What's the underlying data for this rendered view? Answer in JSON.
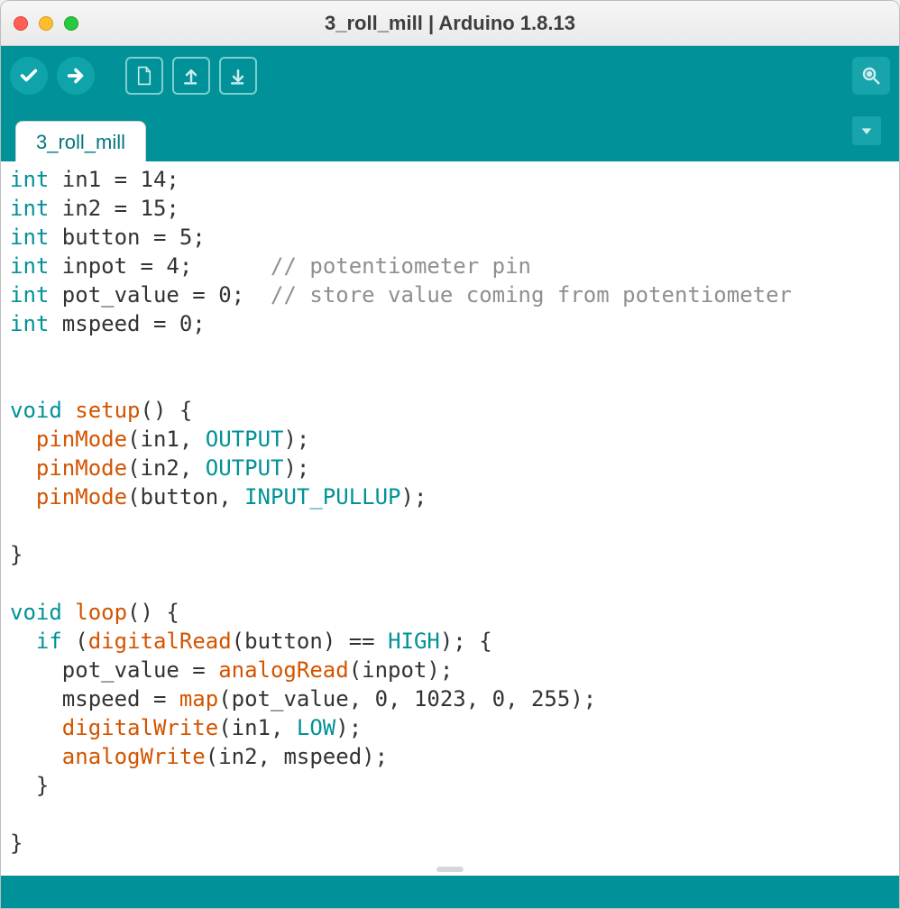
{
  "window": {
    "title": "3_roll_mill | Arduino 1.8.13"
  },
  "tabs": {
    "active_label": "3_roll_mill"
  },
  "code": {
    "lines": [
      {
        "t": "decl",
        "type": "int",
        "name": "in1",
        "val": "14",
        "cm": ""
      },
      {
        "t": "decl",
        "type": "int",
        "name": "in2",
        "val": "15",
        "cm": ""
      },
      {
        "t": "decl",
        "type": "int",
        "name": "button",
        "val": "5",
        "cm": ""
      },
      {
        "t": "decl",
        "type": "int",
        "name": "inpot",
        "val": "4",
        "cm": "// potentiometer pin"
      },
      {
        "t": "decl",
        "type": "int",
        "name": "pot_value",
        "val": "0",
        "cm": "// store value coming from potentiometer"
      },
      {
        "t": "decl",
        "type": "int",
        "name": "mspeed",
        "val": "0",
        "cm": ""
      },
      {
        "t": "blank"
      },
      {
        "t": "blank"
      },
      {
        "t": "raw",
        "seg": [
          [
            "kw",
            "void "
          ],
          [
            "func",
            "setup"
          ],
          [
            "",
            "() {"
          ]
        ]
      },
      {
        "t": "raw",
        "seg": [
          [
            "",
            "  "
          ],
          [
            "func",
            "pinMode"
          ],
          [
            "",
            "(in1, "
          ],
          [
            "const",
            "OUTPUT"
          ],
          [
            "",
            ");"
          ]
        ]
      },
      {
        "t": "raw",
        "seg": [
          [
            "",
            "  "
          ],
          [
            "func",
            "pinMode"
          ],
          [
            "",
            "(in2, "
          ],
          [
            "const",
            "OUTPUT"
          ],
          [
            "",
            ");"
          ]
        ]
      },
      {
        "t": "raw",
        "seg": [
          [
            "",
            "  "
          ],
          [
            "func",
            "pinMode"
          ],
          [
            "",
            "(button, "
          ],
          [
            "const",
            "INPUT_PULLUP"
          ],
          [
            "",
            ");"
          ]
        ]
      },
      {
        "t": "blank"
      },
      {
        "t": "raw",
        "seg": [
          [
            "",
            "}"
          ]
        ]
      },
      {
        "t": "blank"
      },
      {
        "t": "raw",
        "seg": [
          [
            "kw",
            "void "
          ],
          [
            "func",
            "loop"
          ],
          [
            "",
            "() {"
          ]
        ]
      },
      {
        "t": "raw",
        "seg": [
          [
            "",
            "  "
          ],
          [
            "kw",
            "if"
          ],
          [
            "",
            " ("
          ],
          [
            "func",
            "digitalRead"
          ],
          [
            "",
            "(button) == "
          ],
          [
            "const",
            "HIGH"
          ],
          [
            "",
            "); {"
          ]
        ]
      },
      {
        "t": "raw",
        "seg": [
          [
            "",
            "    pot_value = "
          ],
          [
            "func",
            "analogRead"
          ],
          [
            "",
            "(inpot);"
          ]
        ]
      },
      {
        "t": "raw",
        "seg": [
          [
            "",
            "    mspeed = "
          ],
          [
            "func",
            "map"
          ],
          [
            "",
            "(pot_value, 0, 1023, 0, 255);"
          ]
        ]
      },
      {
        "t": "raw",
        "seg": [
          [
            "",
            "    "
          ],
          [
            "func",
            "digitalWrite"
          ],
          [
            "",
            "(in1, "
          ],
          [
            "const",
            "LOW"
          ],
          [
            "",
            ");"
          ]
        ]
      },
      {
        "t": "raw",
        "seg": [
          [
            "",
            "    "
          ],
          [
            "func",
            "analogWrite"
          ],
          [
            "",
            "(in2, mspeed);"
          ]
        ]
      },
      {
        "t": "raw",
        "seg": [
          [
            "",
            "  }"
          ]
        ]
      },
      {
        "t": "blank"
      },
      {
        "t": "raw",
        "seg": [
          [
            "",
            "}"
          ]
        ]
      }
    ],
    "decl_comment_col": 20
  }
}
